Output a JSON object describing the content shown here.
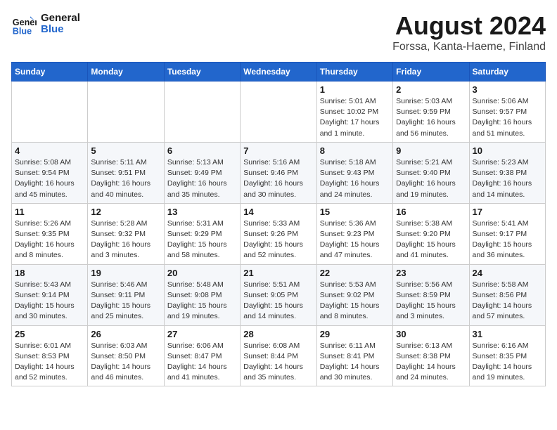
{
  "header": {
    "logo_line1": "General",
    "logo_line2": "Blue",
    "title": "August 2024",
    "subtitle": "Forssa, Kanta-Haeme, Finland"
  },
  "weekdays": [
    "Sunday",
    "Monday",
    "Tuesday",
    "Wednesday",
    "Thursday",
    "Friday",
    "Saturday"
  ],
  "weeks": [
    [
      {
        "day": "",
        "info": ""
      },
      {
        "day": "",
        "info": ""
      },
      {
        "day": "",
        "info": ""
      },
      {
        "day": "",
        "info": ""
      },
      {
        "day": "1",
        "info": "Sunrise: 5:01 AM\nSunset: 10:02 PM\nDaylight: 17 hours\nand 1 minute."
      },
      {
        "day": "2",
        "info": "Sunrise: 5:03 AM\nSunset: 9:59 PM\nDaylight: 16 hours\nand 56 minutes."
      },
      {
        "day": "3",
        "info": "Sunrise: 5:06 AM\nSunset: 9:57 PM\nDaylight: 16 hours\nand 51 minutes."
      }
    ],
    [
      {
        "day": "4",
        "info": "Sunrise: 5:08 AM\nSunset: 9:54 PM\nDaylight: 16 hours\nand 45 minutes."
      },
      {
        "day": "5",
        "info": "Sunrise: 5:11 AM\nSunset: 9:51 PM\nDaylight: 16 hours\nand 40 minutes."
      },
      {
        "day": "6",
        "info": "Sunrise: 5:13 AM\nSunset: 9:49 PM\nDaylight: 16 hours\nand 35 minutes."
      },
      {
        "day": "7",
        "info": "Sunrise: 5:16 AM\nSunset: 9:46 PM\nDaylight: 16 hours\nand 30 minutes."
      },
      {
        "day": "8",
        "info": "Sunrise: 5:18 AM\nSunset: 9:43 PM\nDaylight: 16 hours\nand 24 minutes."
      },
      {
        "day": "9",
        "info": "Sunrise: 5:21 AM\nSunset: 9:40 PM\nDaylight: 16 hours\nand 19 minutes."
      },
      {
        "day": "10",
        "info": "Sunrise: 5:23 AM\nSunset: 9:38 PM\nDaylight: 16 hours\nand 14 minutes."
      }
    ],
    [
      {
        "day": "11",
        "info": "Sunrise: 5:26 AM\nSunset: 9:35 PM\nDaylight: 16 hours\nand 8 minutes."
      },
      {
        "day": "12",
        "info": "Sunrise: 5:28 AM\nSunset: 9:32 PM\nDaylight: 16 hours\nand 3 minutes."
      },
      {
        "day": "13",
        "info": "Sunrise: 5:31 AM\nSunset: 9:29 PM\nDaylight: 15 hours\nand 58 minutes."
      },
      {
        "day": "14",
        "info": "Sunrise: 5:33 AM\nSunset: 9:26 PM\nDaylight: 15 hours\nand 52 minutes."
      },
      {
        "day": "15",
        "info": "Sunrise: 5:36 AM\nSunset: 9:23 PM\nDaylight: 15 hours\nand 47 minutes."
      },
      {
        "day": "16",
        "info": "Sunrise: 5:38 AM\nSunset: 9:20 PM\nDaylight: 15 hours\nand 41 minutes."
      },
      {
        "day": "17",
        "info": "Sunrise: 5:41 AM\nSunset: 9:17 PM\nDaylight: 15 hours\nand 36 minutes."
      }
    ],
    [
      {
        "day": "18",
        "info": "Sunrise: 5:43 AM\nSunset: 9:14 PM\nDaylight: 15 hours\nand 30 minutes."
      },
      {
        "day": "19",
        "info": "Sunrise: 5:46 AM\nSunset: 9:11 PM\nDaylight: 15 hours\nand 25 minutes."
      },
      {
        "day": "20",
        "info": "Sunrise: 5:48 AM\nSunset: 9:08 PM\nDaylight: 15 hours\nand 19 minutes."
      },
      {
        "day": "21",
        "info": "Sunrise: 5:51 AM\nSunset: 9:05 PM\nDaylight: 15 hours\nand 14 minutes."
      },
      {
        "day": "22",
        "info": "Sunrise: 5:53 AM\nSunset: 9:02 PM\nDaylight: 15 hours\nand 8 minutes."
      },
      {
        "day": "23",
        "info": "Sunrise: 5:56 AM\nSunset: 8:59 PM\nDaylight: 15 hours\nand 3 minutes."
      },
      {
        "day": "24",
        "info": "Sunrise: 5:58 AM\nSunset: 8:56 PM\nDaylight: 14 hours\nand 57 minutes."
      }
    ],
    [
      {
        "day": "25",
        "info": "Sunrise: 6:01 AM\nSunset: 8:53 PM\nDaylight: 14 hours\nand 52 minutes."
      },
      {
        "day": "26",
        "info": "Sunrise: 6:03 AM\nSunset: 8:50 PM\nDaylight: 14 hours\nand 46 minutes."
      },
      {
        "day": "27",
        "info": "Sunrise: 6:06 AM\nSunset: 8:47 PM\nDaylight: 14 hours\nand 41 minutes."
      },
      {
        "day": "28",
        "info": "Sunrise: 6:08 AM\nSunset: 8:44 PM\nDaylight: 14 hours\nand 35 minutes."
      },
      {
        "day": "29",
        "info": "Sunrise: 6:11 AM\nSunset: 8:41 PM\nDaylight: 14 hours\nand 30 minutes."
      },
      {
        "day": "30",
        "info": "Sunrise: 6:13 AM\nSunset: 8:38 PM\nDaylight: 14 hours\nand 24 minutes."
      },
      {
        "day": "31",
        "info": "Sunrise: 6:16 AM\nSunset: 8:35 PM\nDaylight: 14 hours\nand 19 minutes."
      }
    ]
  ]
}
